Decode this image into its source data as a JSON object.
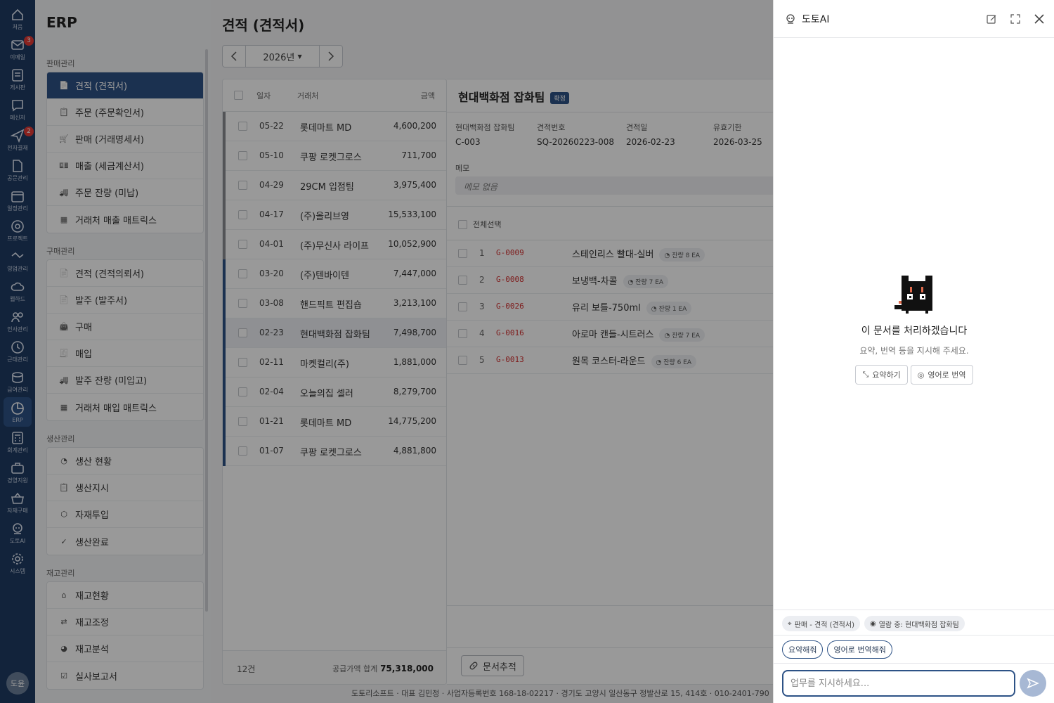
{
  "rail": {
    "items": [
      {
        "label": "처음",
        "icon": "home-icon"
      },
      {
        "label": "이메일",
        "icon": "mail-icon",
        "badge": "3"
      },
      {
        "label": "게시판",
        "icon": "board-icon"
      },
      {
        "label": "메신저",
        "icon": "chat-icon"
      },
      {
        "label": "전자결재",
        "icon": "approval-icon",
        "badge": "2"
      },
      {
        "label": "공문관리",
        "icon": "document-edit-icon"
      },
      {
        "label": "일정관리",
        "icon": "calendar-icon"
      },
      {
        "label": "프로젝트",
        "icon": "target-icon"
      },
      {
        "label": "영업관리",
        "icon": "handshake-icon"
      },
      {
        "label": "웹하드",
        "icon": "cloud-icon"
      },
      {
        "label": "인사관리",
        "icon": "people-icon"
      },
      {
        "label": "근태관리",
        "icon": "clock-icon"
      },
      {
        "label": "급여관리",
        "icon": "coins-icon"
      },
      {
        "label": "ERP",
        "icon": "pie-chart-icon"
      },
      {
        "label": "회계관리",
        "icon": "calculator-icon"
      },
      {
        "label": "경영지원",
        "icon": "briefcase-icon"
      },
      {
        "label": "자재구매",
        "icon": "basket-icon"
      },
      {
        "label": "도토AI",
        "icon": "robot-icon"
      },
      {
        "label": "시스템",
        "icon": "gear-icon"
      }
    ],
    "avatar": "도윤"
  },
  "nav": {
    "title": "ERP",
    "groups": [
      {
        "title": "판매관리",
        "items": [
          {
            "label": "견적 (견적서)",
            "icon": "document-icon"
          },
          {
            "label": "주문 (주문확인서)",
            "icon": "clipboard-icon"
          },
          {
            "label": "판매 (거래명세서)",
            "icon": "cart-icon"
          },
          {
            "label": "매출 (세금계산서)",
            "icon": "money-icon"
          },
          {
            "label": "주문 잔량 (미납)",
            "icon": "truck-icon"
          },
          {
            "label": "거래처 매출 매트릭스",
            "icon": "grid-icon"
          }
        ]
      },
      {
        "title": "구매관리",
        "items": [
          {
            "label": "견적 (견적의뢰서)",
            "icon": "document-icon"
          },
          {
            "label": "발주 (발주서)",
            "icon": "document-icon"
          },
          {
            "label": "구매",
            "icon": "bag-icon"
          },
          {
            "label": "매입",
            "icon": "receipt-icon"
          },
          {
            "label": "발주 잔량 (미입고)",
            "icon": "truck-icon"
          },
          {
            "label": "거래처 매입 매트릭스",
            "icon": "grid-icon"
          }
        ]
      },
      {
        "title": "생산관리",
        "items": [
          {
            "label": "생산 현황",
            "icon": "gauge-icon"
          },
          {
            "label": "생산지시",
            "icon": "clipboard-icon"
          },
          {
            "label": "자재투입",
            "icon": "box-icon"
          },
          {
            "label": "생산완료",
            "icon": "check-circle-icon"
          }
        ]
      },
      {
        "title": "재고관리",
        "items": [
          {
            "label": "재고현황",
            "icon": "warehouse-icon"
          },
          {
            "label": "재고조정",
            "icon": "swap-icon"
          },
          {
            "label": "재고분석",
            "icon": "pie-icon"
          },
          {
            "label": "실사보고서",
            "icon": "clipboard-check-icon"
          }
        ]
      }
    ]
  },
  "main": {
    "title": "견적 (견적서)",
    "year": "2026년",
    "list": {
      "headers": {
        "date": "일자",
        "client": "거래처",
        "amount": "금액"
      },
      "rows": [
        {
          "date": "05-22",
          "client": "롯데마트 MD",
          "amount": "4,600,200",
          "bar": "#8a8d92"
        },
        {
          "date": "05-10",
          "client": "쿠팡 로켓그로스",
          "amount": "711,700",
          "bar": "#8a8d92"
        },
        {
          "date": "04-29",
          "client": "29CM 입점팀",
          "amount": "3,975,400",
          "bar": "#8a8d92"
        },
        {
          "date": "04-17",
          "client": "(주)올리브영",
          "amount": "15,533,100",
          "bar": "#8a8d92"
        },
        {
          "date": "04-01",
          "client": "(주)무신사 라이프",
          "amount": "10,052,900",
          "bar": "#8a8d92"
        },
        {
          "date": "03-20",
          "client": "(주)텐바이텐",
          "amount": "7,447,000",
          "bar": "#2d5286"
        },
        {
          "date": "03-08",
          "client": "핸드픽트 편집숍",
          "amount": "3,213,100",
          "bar": "#2d5286"
        },
        {
          "date": "02-23",
          "client": "현대백화점 잡화팀",
          "amount": "7,498,700",
          "bar": "#2d5286"
        },
        {
          "date": "02-11",
          "client": "마켓컬리(주)",
          "amount": "1,881,000",
          "bar": "#2d5286"
        },
        {
          "date": "02-04",
          "client": "오늘의집 셀러",
          "amount": "8,279,700",
          "bar": "#2d5286"
        },
        {
          "date": "01-21",
          "client": "롯데마트 MD",
          "amount": "14,775,200",
          "bar": "#2d5286"
        },
        {
          "date": "01-07",
          "client": "쿠팡 로켓그로스",
          "amount": "4,881,800",
          "bar": "#2d5286"
        }
      ],
      "count": "12건",
      "total_label": "공급가액 합계",
      "total": "75,318,000"
    },
    "detail": {
      "title": "현대백화점 잡화팀",
      "status": "확정",
      "meta": [
        {
          "label": "현대백화점 잡화팀",
          "value": "C-003"
        },
        {
          "label": "견적번호",
          "value": "SQ-20260223-008"
        },
        {
          "label": "견적일",
          "value": "2026-02-23"
        },
        {
          "label": "유효기한",
          "value": "2026-03-25"
        }
      ],
      "memo_label": "메모",
      "memo": "메모 없음",
      "select_all": "전체선택",
      "items": [
        {
          "no": "1",
          "code": "G-0009",
          "name": "스테인리스 빨대-실버",
          "remain": "잔량 8 EA"
        },
        {
          "no": "2",
          "code": "G-0008",
          "name": "보냉백-차콜",
          "remain": "잔량 7 EA"
        },
        {
          "no": "3",
          "code": "G-0026",
          "name": "유리 보틀-750ml",
          "remain": "잔량 1 EA"
        },
        {
          "no": "4",
          "code": "G-0016",
          "name": "아로마 캔들-시트러스",
          "remain": "잔량 7 EA"
        },
        {
          "no": "5",
          "code": "G-0013",
          "name": "원목 코스터-라운드",
          "remain": "잔량 6 EA"
        }
      ],
      "trace_button": "문서추적"
    },
    "footer": "도토리소프트 · 대표 김민정 · 사업자등록번호 168-18-02217 · 경기도 고양시 일산동구 정발산로 15, 414호 · 010-2401-790"
  },
  "ai": {
    "title": "도토AI",
    "empty_title": "이 문서를 처리하겠습니다",
    "empty_sub": "요약, 번역 등을 지시해 주세요.",
    "btn_summary": "요약하기",
    "btn_translate": "영어로 번역",
    "ctx_location": "판매 - 견적 (견적서)",
    "ctx_viewing": "열람 중: 현대백화점 잡화팀",
    "sugg1": "요약해줘",
    "sugg2": "영어로 번역해줘",
    "input_placeholder": "업무를 지시하세요..."
  },
  "colors": {
    "accent": "#2d5286",
    "rail": "#1f3b63",
    "code_red": "#d32f2f"
  }
}
